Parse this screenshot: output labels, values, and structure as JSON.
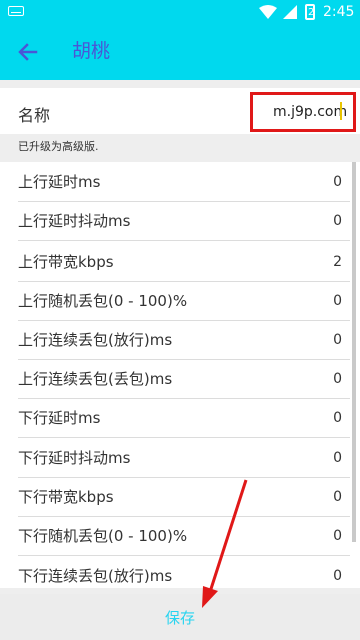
{
  "app": {
    "title": "胡桃",
    "time": "2:45",
    "battery_label": "2"
  },
  "name_field": {
    "label": "名称",
    "value": "m.j9p.com"
  },
  "info_text": "已升级为高级版.",
  "rows": [
    {
      "label": "上行延时ms",
      "value": "0"
    },
    {
      "label": "上行延时抖动ms",
      "value": "0"
    },
    {
      "label": "上行带宽kbps",
      "value": "2"
    },
    {
      "label": "上行随机丢包(0 - 100)%",
      "value": "0"
    },
    {
      "label": "上行连续丢包(放行)ms",
      "value": "0"
    },
    {
      "label": "上行连续丢包(丢包)ms",
      "value": "0"
    },
    {
      "label": "下行延时ms",
      "value": "0"
    },
    {
      "label": "下行延时抖动ms",
      "value": "0"
    },
    {
      "label": "下行带宽kbps",
      "value": "0"
    },
    {
      "label": "下行随机丢包(0 - 100)%",
      "value": "0"
    },
    {
      "label": "下行连续丢包(放行)ms",
      "value": "0"
    }
  ],
  "save_label": "保存",
  "colors": {
    "toolbar": "#00d9ee",
    "title": "#4a56d6",
    "highlight_box": "#e01818",
    "save_text": "#28d4f0",
    "annotation_arrow": "#e01818"
  },
  "icons": {
    "back": "arrow-left-icon",
    "wifi": "wifi-icon",
    "signal": "signal-icon",
    "battery": "battery-icon",
    "keyboard": "keyboard-icon"
  }
}
